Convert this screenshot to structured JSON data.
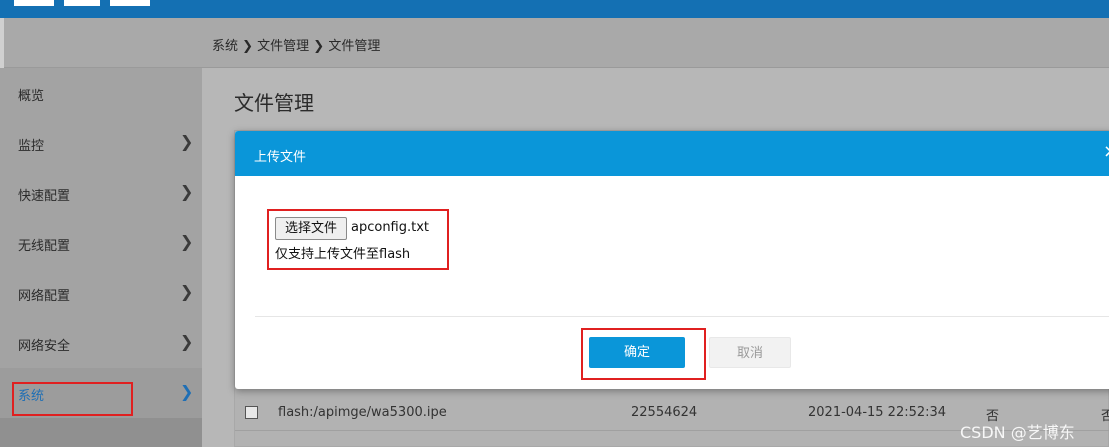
{
  "breadcrumb": "系统 ❯ 文件管理 ❯ 文件管理",
  "sidebar": {
    "items": [
      {
        "label": "概览",
        "chevron": ""
      },
      {
        "label": "监控",
        "chevron": "❯"
      },
      {
        "label": "快速配置",
        "chevron": "❯"
      },
      {
        "label": "无线配置",
        "chevron": "❯"
      },
      {
        "label": "网络配置",
        "chevron": "❯"
      },
      {
        "label": "网络安全",
        "chevron": "❯"
      },
      {
        "label": "系统",
        "chevron": "❯"
      }
    ]
  },
  "main": {
    "title": "文件管理"
  },
  "table": {
    "row": {
      "name": "flash:/apimge/wa5300.ipe",
      "size": "22554624",
      "date": "2021-04-15 22:52:34",
      "flag1": "否",
      "flag2": "否"
    }
  },
  "modal": {
    "title": "上传文件",
    "close": "×",
    "choose_file": "选择文件",
    "file_name": "apconfig.txt",
    "hint": "仅支持上传文件至flash",
    "ok": "确定",
    "cancel": "取消"
  },
  "watermark": "CSDN @艺博东",
  "colors": {
    "header": "#0a96d9",
    "topbar": "#1470b3",
    "annotation": "#e02020"
  }
}
